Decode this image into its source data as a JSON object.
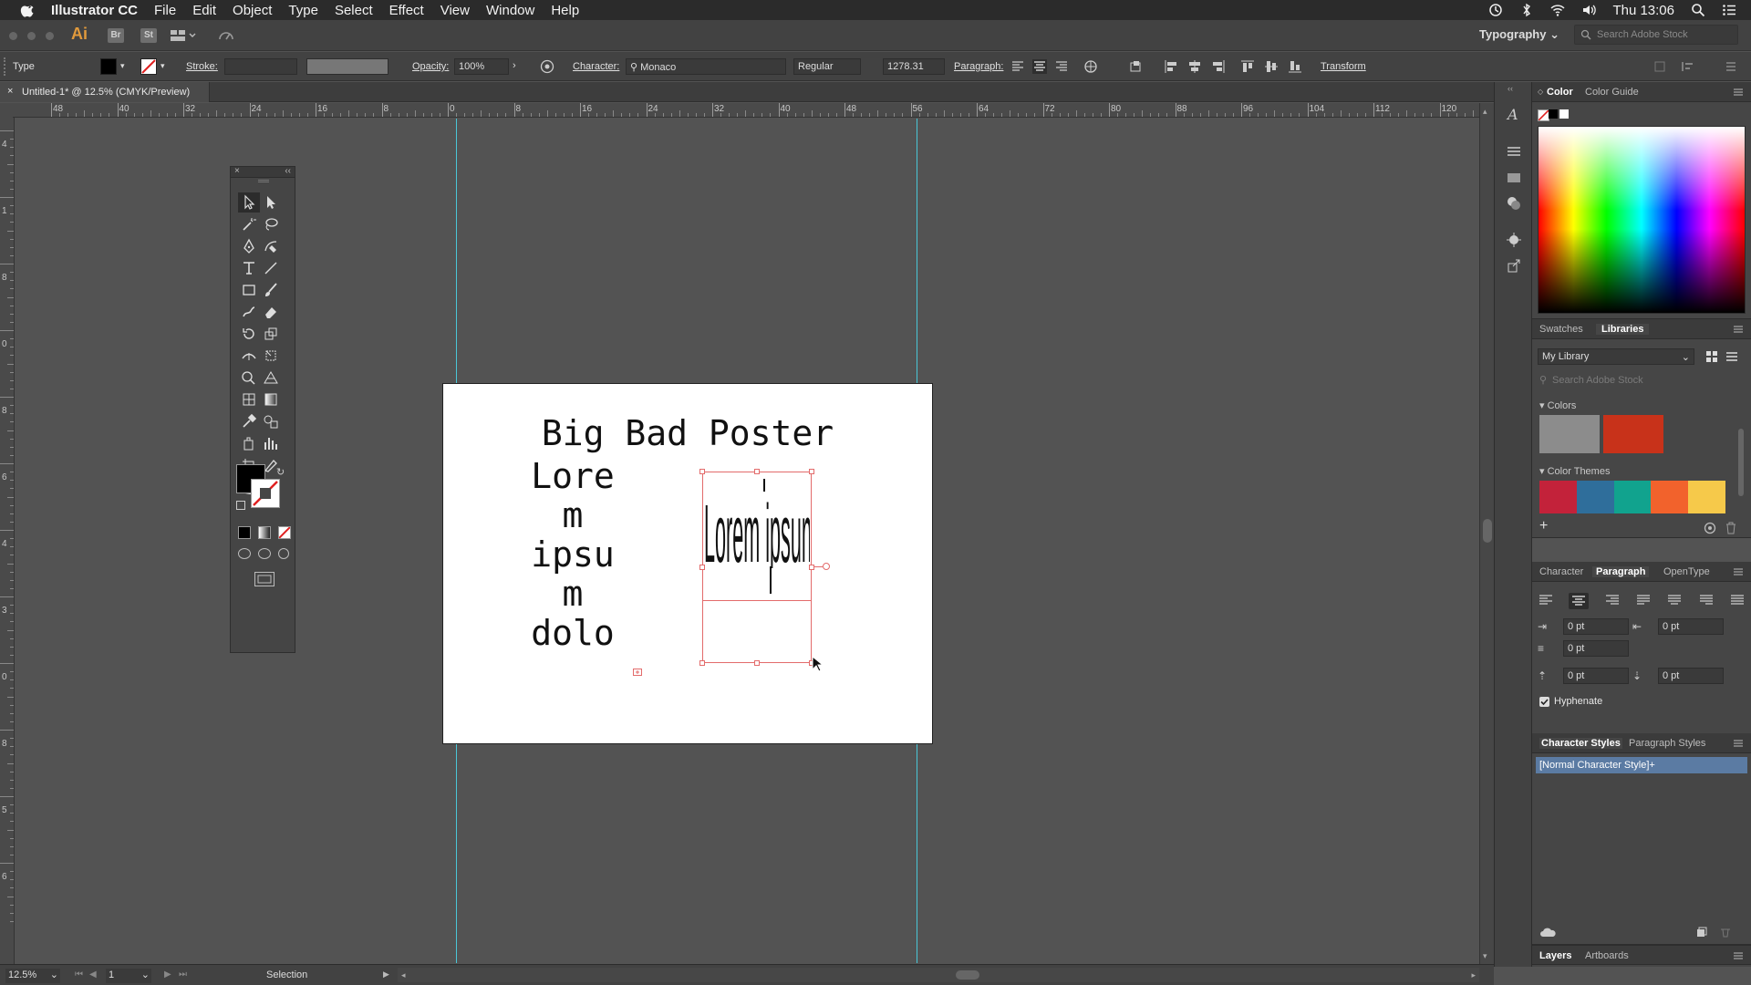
{
  "menubar": {
    "app_name": "Illustrator CC",
    "menus": [
      "File",
      "Edit",
      "Object",
      "Type",
      "Select",
      "Effect",
      "View",
      "Window",
      "Help"
    ],
    "clock": "Thu 13:06"
  },
  "appbar": {
    "ai_badge": "Ai",
    "bridge_badge": "Br",
    "stock_badge": "St",
    "workspace": "Typography",
    "search_placeholder": "Search Adobe Stock"
  },
  "control_bar": {
    "selection_type": "Type",
    "stroke_label": "Stroke:",
    "opacity_label": "Opacity:",
    "opacity_value": "100%",
    "character_label": "Character:",
    "font_family": "Monaco",
    "font_style": "Regular",
    "font_size": "1278.31",
    "paragraph_label": "Paragraph:",
    "transform_label": "Transform"
  },
  "document": {
    "tab_title": "Untitled-1* @ 12.5% (CMYK/Preview)"
  },
  "ruler": {
    "h_labels": [
      "48",
      "40",
      "32",
      "24",
      "16",
      "8",
      "0",
      "8",
      "16",
      "24",
      "32",
      "40",
      "48",
      "56",
      "64",
      "72",
      "80",
      "88",
      "96",
      "104",
      "112",
      "120"
    ],
    "v_labels": [
      "4",
      "1",
      "8",
      "0",
      "8",
      "6",
      "4",
      "3",
      "0",
      "8",
      "5",
      "6"
    ]
  },
  "artboard": {
    "title": "Big Bad Poster",
    "text_lines": [
      "Lore",
      "m",
      "ipsu",
      "m",
      "dolo"
    ],
    "compressed_text": "Lorem ipsum"
  },
  "panels": {
    "color": {
      "tabs": [
        "Color",
        "Color Guide"
      ]
    },
    "libraries": {
      "tabs": [
        "Swatches",
        "Libraries"
      ],
      "library_name": "My Library",
      "search_placeholder": "Search Adobe Stock",
      "colors_label": "Colors",
      "colors": [
        "#8c8c8c",
        "#c8321a"
      ],
      "themes_label": "Color Themes",
      "theme_colors": [
        "#c3223a",
        "#2f6e9b",
        "#11a38e",
        "#f2622c",
        "#f6c94a"
      ]
    },
    "paragraph": {
      "tabs": [
        "Character",
        "Paragraph",
        "OpenType"
      ],
      "left_indent": "0 pt",
      "right_indent": "0 pt",
      "first_line_indent": "0 pt",
      "space_before": "0 pt",
      "space_after": "0 pt",
      "hyphenate_label": "Hyphenate"
    },
    "character_styles": {
      "tabs": [
        "Character Styles",
        "Paragraph Styles"
      ],
      "items": [
        "[Normal Character Style]+"
      ]
    },
    "layers": {
      "tabs": [
        "Layers",
        "Artboards"
      ]
    }
  },
  "status": {
    "zoom": "12.5%",
    "artboard_number": "1",
    "tool_name": "Selection"
  }
}
